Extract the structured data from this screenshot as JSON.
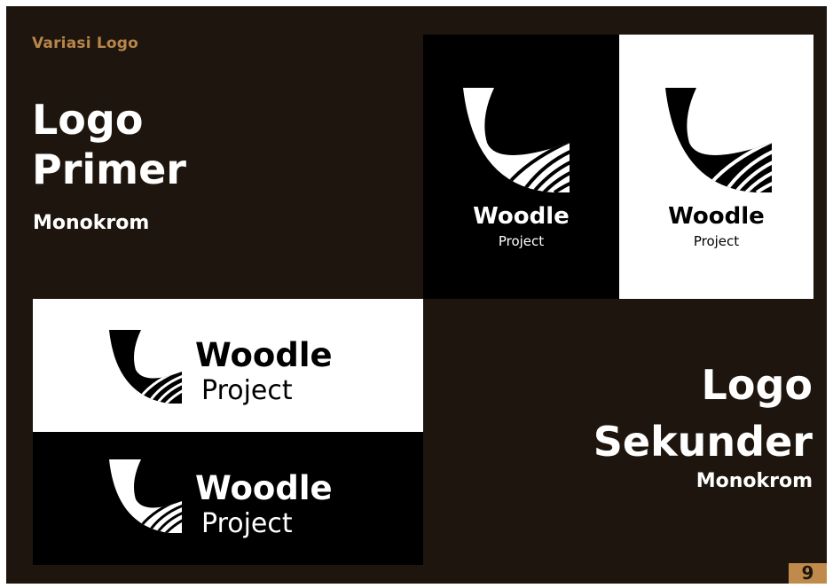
{
  "section_label": "Variasi Logo",
  "primary": {
    "title_line1": "Logo",
    "title_line2": "Primer",
    "subtitle": "Monokrom"
  },
  "secondary": {
    "title_line1": "Logo",
    "title_line2": "Sekunder",
    "subtitle": "Monokrom"
  },
  "logo": {
    "wordmark": "Woodle",
    "tagline": "Project"
  },
  "page_number": "9",
  "colors": {
    "background": "#1e160e",
    "accent": "#b8864b",
    "page_badge": "#c08a4c",
    "black": "#000000",
    "white": "#ffffff"
  }
}
